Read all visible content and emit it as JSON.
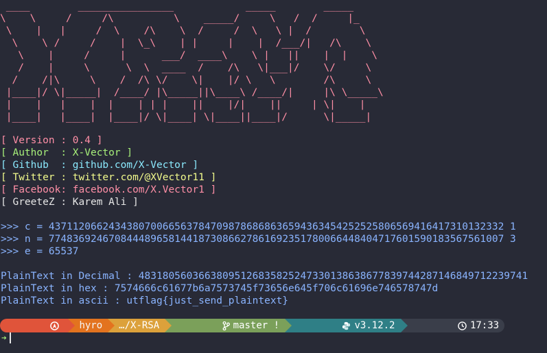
{
  "banner": {
    "ascii": " ____        ________________            _____        _____\n\\    \\     /     /\\          \\    _____/     \\   /  /     |_\n \\    |   |     /  \\    /\\    \\  /     /  \\   \\ |  /        \\\n  \\    \\ /     /    |  \\_\\    | |     |    |  /___/|   /\\    \\\n   \\    |     /     |      ___/  ____\\    \\ |   ||    |  |    \\\n   /    |     \\      \\  \\  ____  /    /\\   \\|___|/    \\/     \\\n  /    /|\\     \\    /  /\\ \\/    \\|    |/ \\   \\        /\\     \\\n |____|/ \\|_____|  /____/ |\\_____||\\____\\ /____/|     |\\ \\_____\\\n |    |   |    |  |    | | |    ||    |/|    ||     | \\|    |\n |____|   |____|  |____|/ \\|____| \\|____||____|/      \\|_____|"
  },
  "info": [
    {
      "prefix": "[ ",
      "label": "Version ",
      "sep": ": ",
      "value": "0.4",
      "suffix": " ]",
      "color": "#ff8fa6"
    },
    {
      "prefix": "[ ",
      "label": "Author  ",
      "sep": ": ",
      "value": "X-Vector",
      "suffix": " ]",
      "color": "#a7ef7a"
    },
    {
      "prefix": "[ ",
      "label": "Github  ",
      "sep": ": ",
      "value": "github.com/X-Vector",
      "suffix": " ]",
      "color": "#8be9fd"
    },
    {
      "prefix": "[ ",
      "label": "Twitter ",
      "sep": ": ",
      "value": "twitter.com/@XVector11",
      "suffix": " ]",
      "color": "#f1fa8c"
    },
    {
      "prefix": "[ ",
      "label": "Facebook",
      "sep": ": ",
      "value": "facebook.com/X.Vector1",
      "suffix": " ]",
      "color": "#ff8fa6"
    },
    {
      "prefix": "[ ",
      "label": "GreeteZ ",
      "sep": ": ",
      "value": "Karem Ali",
      "suffix": " ]",
      "color": "#e6e6e6"
    }
  ],
  "params": [
    {
      "prompt": ">>> ",
      "name": "c",
      "eq": " = ",
      "value": "4371120662434380700665637847098786868636594363454252525806569416417310132332 1"
    },
    {
      "prompt": ">>> ",
      "name": "n",
      "eq": " = ",
      "value": "7748369246708444896581441873086627861692351780066448404717601590183567561007 3"
    },
    {
      "prompt": ">>> ",
      "name": "e",
      "eq": " = ",
      "value": "65537"
    }
  ],
  "results": [
    {
      "label": "PlainText in Decimal : ",
      "value": "48318056036638095126835825247330138638677839744287146849712239741"
    },
    {
      "label": "PlainText in hex : ",
      "value": "7574666c61677b6a7573745f73656e645f706c61696e746578747d"
    },
    {
      "label": "PlainText in ascii : ",
      "value": "utflag{just_send_plaintext}"
    }
  ],
  "prompt": {
    "os_icon": "arch-icon",
    "user": "hyro",
    "dir": "…/X-RSA",
    "git_icon": "git-branch-icon",
    "branch": "master !",
    "python_icon": "python-icon",
    "python_version": "v3.12.2",
    "clock_icon": "clock-icon",
    "time": "17:33",
    "arrow": "➔"
  },
  "colors": {
    "background": "#282a36",
    "pink": "#ff8fa6",
    "green": "#a7ef7a",
    "cyan": "#8be9fd",
    "yellow": "#f1fa8c",
    "blue": "#8ab4ff"
  }
}
